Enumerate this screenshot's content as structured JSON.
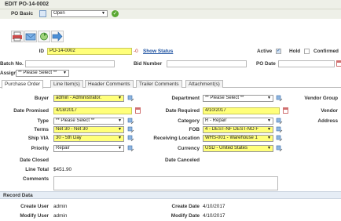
{
  "title": "EDIT PO-14-0002",
  "po_basic": {
    "label": "PO Basic",
    "status_value": "Open"
  },
  "header": {
    "id_label": "ID",
    "id_value": "PO-14-0002",
    "id_suffix": "-0",
    "show_status": "Show Status",
    "active_label": "Active",
    "hold_label": "Hold",
    "confirmed_label": "Confirmed",
    "batch_label": "Batch No.",
    "bid_label": "Bid Number",
    "po_date_label": "PO Date",
    "assign_label": "Assign To",
    "assign_value": "** Please Select **"
  },
  "tabs": [
    "Purchase Order",
    "Line Item(s)",
    "Header Comments",
    "Trailer Comments",
    "Attachment(s)"
  ],
  "form": {
    "buyer_label": "Buyer",
    "buyer_value": "admin - Administrator.",
    "department_label": "Department",
    "department_value": "** Please Select **",
    "vendor_group_label": "Vendor Group",
    "date_promised_label": "Date Promised",
    "date_promised_value": "4/18/2017",
    "date_required_label": "Date Required",
    "date_required_value": "4/10/2017",
    "vendor_label": "Vendor",
    "type_label": "Type",
    "type_value": "** Please Select **",
    "category_label": "Category",
    "category_value": "R - Repair",
    "address_label": "Address",
    "terms_label": "Terms",
    "terms_value": "Net 30 - Net 30",
    "fob_label": "FOB",
    "fob_value": "4 - DEST-NF DEST-NO F",
    "ship_via_label": "Ship VIA",
    "ship_via_value": "30 - 5th Day",
    "receiving_label": "Receiving Location",
    "receiving_value": "WHS-001 - Warehouse 1",
    "priority_label": "Priority",
    "priority_value": "Repair",
    "currency_label": "Currency",
    "currency_value": "USD - United States",
    "date_closed_label": "Date Closed",
    "date_canceled_label": "Date Canceled",
    "line_total_label": "Line Total",
    "line_total_value": "$451.90",
    "comments_label": "Comments"
  },
  "record": {
    "section_title": "Record Data",
    "create_user_label": "Create User",
    "create_user_value": "admin",
    "create_date_label": "Create Date",
    "create_date_value": "4/10/2017",
    "modify_user_label": "Modify User",
    "modify_user_value": "admin",
    "modify_date_label": "Modify Date",
    "modify_date_value": "4/10/2017"
  },
  "colors": {
    "required_field": "#ffff7a",
    "link": "#1a4fa0",
    "title_bar": "#eef0e8"
  }
}
